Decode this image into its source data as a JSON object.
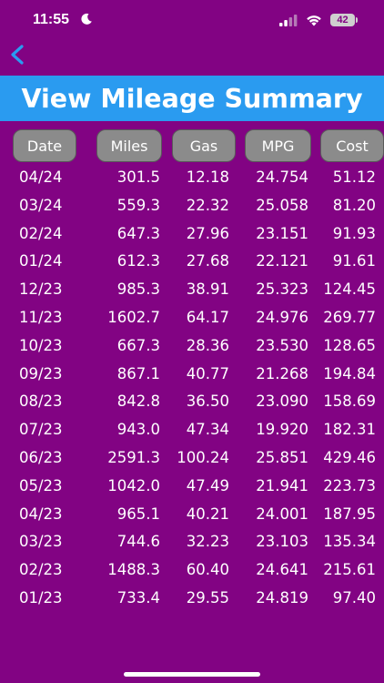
{
  "status_bar": {
    "time": "11:55",
    "battery": "42"
  },
  "nav": {
    "back_icon": "chevron-left-icon",
    "title": "View Mileage Summary"
  },
  "columns": [
    "Date",
    "Miles",
    "Gas",
    "MPG",
    "Cost"
  ],
  "rows": [
    {
      "date": "04/24",
      "miles": "301.5",
      "gas": "12.18",
      "mpg": "24.754",
      "cost": "51.12"
    },
    {
      "date": "03/24",
      "miles": "559.3",
      "gas": "22.32",
      "mpg": "25.058",
      "cost": "81.20"
    },
    {
      "date": "02/24",
      "miles": "647.3",
      "gas": "27.96",
      "mpg": "23.151",
      "cost": "91.93"
    },
    {
      "date": "01/24",
      "miles": "612.3",
      "gas": "27.68",
      "mpg": "22.121",
      "cost": "91.61"
    },
    {
      "date": "12/23",
      "miles": "985.3",
      "gas": "38.91",
      "mpg": "25.323",
      "cost": "124.45"
    },
    {
      "date": "11/23",
      "miles": "1602.7",
      "gas": "64.17",
      "mpg": "24.976",
      "cost": "269.77"
    },
    {
      "date": "10/23",
      "miles": "667.3",
      "gas": "28.36",
      "mpg": "23.530",
      "cost": "128.65"
    },
    {
      "date": "09/23",
      "miles": "867.1",
      "gas": "40.77",
      "mpg": "21.268",
      "cost": "194.84"
    },
    {
      "date": "08/23",
      "miles": "842.8",
      "gas": "36.50",
      "mpg": "23.090",
      "cost": "158.69"
    },
    {
      "date": "07/23",
      "miles": "943.0",
      "gas": "47.34",
      "mpg": "19.920",
      "cost": "182.31"
    },
    {
      "date": "06/23",
      "miles": "2591.3",
      "gas": "100.24",
      "mpg": "25.851",
      "cost": "429.46"
    },
    {
      "date": "05/23",
      "miles": "1042.0",
      "gas": "47.49",
      "mpg": "21.941",
      "cost": "223.73"
    },
    {
      "date": "04/23",
      "miles": "965.1",
      "gas": "40.21",
      "mpg": "24.001",
      "cost": "187.95"
    },
    {
      "date": "03/23",
      "miles": "744.6",
      "gas": "32.23",
      "mpg": "23.103",
      "cost": "135.34"
    },
    {
      "date": "02/23",
      "miles": "1488.3",
      "gas": "60.40",
      "mpg": "24.641",
      "cost": "215.61"
    },
    {
      "date": "01/23",
      "miles": "733.4",
      "gas": "29.55",
      "mpg": "24.819",
      "cost": "97.40"
    }
  ],
  "colors": {
    "background": "#820383",
    "title_bar": "#2a9bf0",
    "back_icon": "#2a9bf0",
    "header_button": "#8b8b8b",
    "text": "#ffffff"
  }
}
